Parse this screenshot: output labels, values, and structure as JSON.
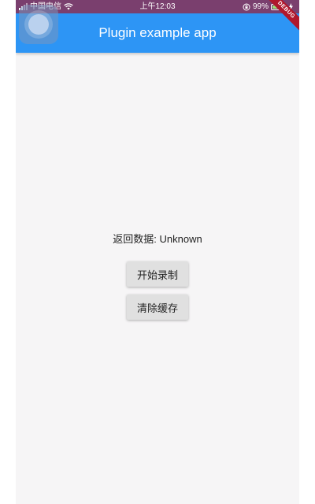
{
  "status_bar": {
    "carrier": "中国电信",
    "time": "上午12:03",
    "battery_percent": "99%",
    "icons": [
      "signal-icon",
      "wifi-icon",
      "orientation-lock-icon",
      "battery-icon",
      "charging-icon"
    ],
    "background_color": "#7a3f6e"
  },
  "app_bar": {
    "title": "Plugin example app",
    "background_color": "#2d95f5"
  },
  "debug_banner": {
    "label": "DEBUG"
  },
  "main": {
    "result_text": "返回数据: Unknown",
    "buttons": [
      {
        "label": "开始录制"
      },
      {
        "label": "清除缓存"
      }
    ]
  }
}
